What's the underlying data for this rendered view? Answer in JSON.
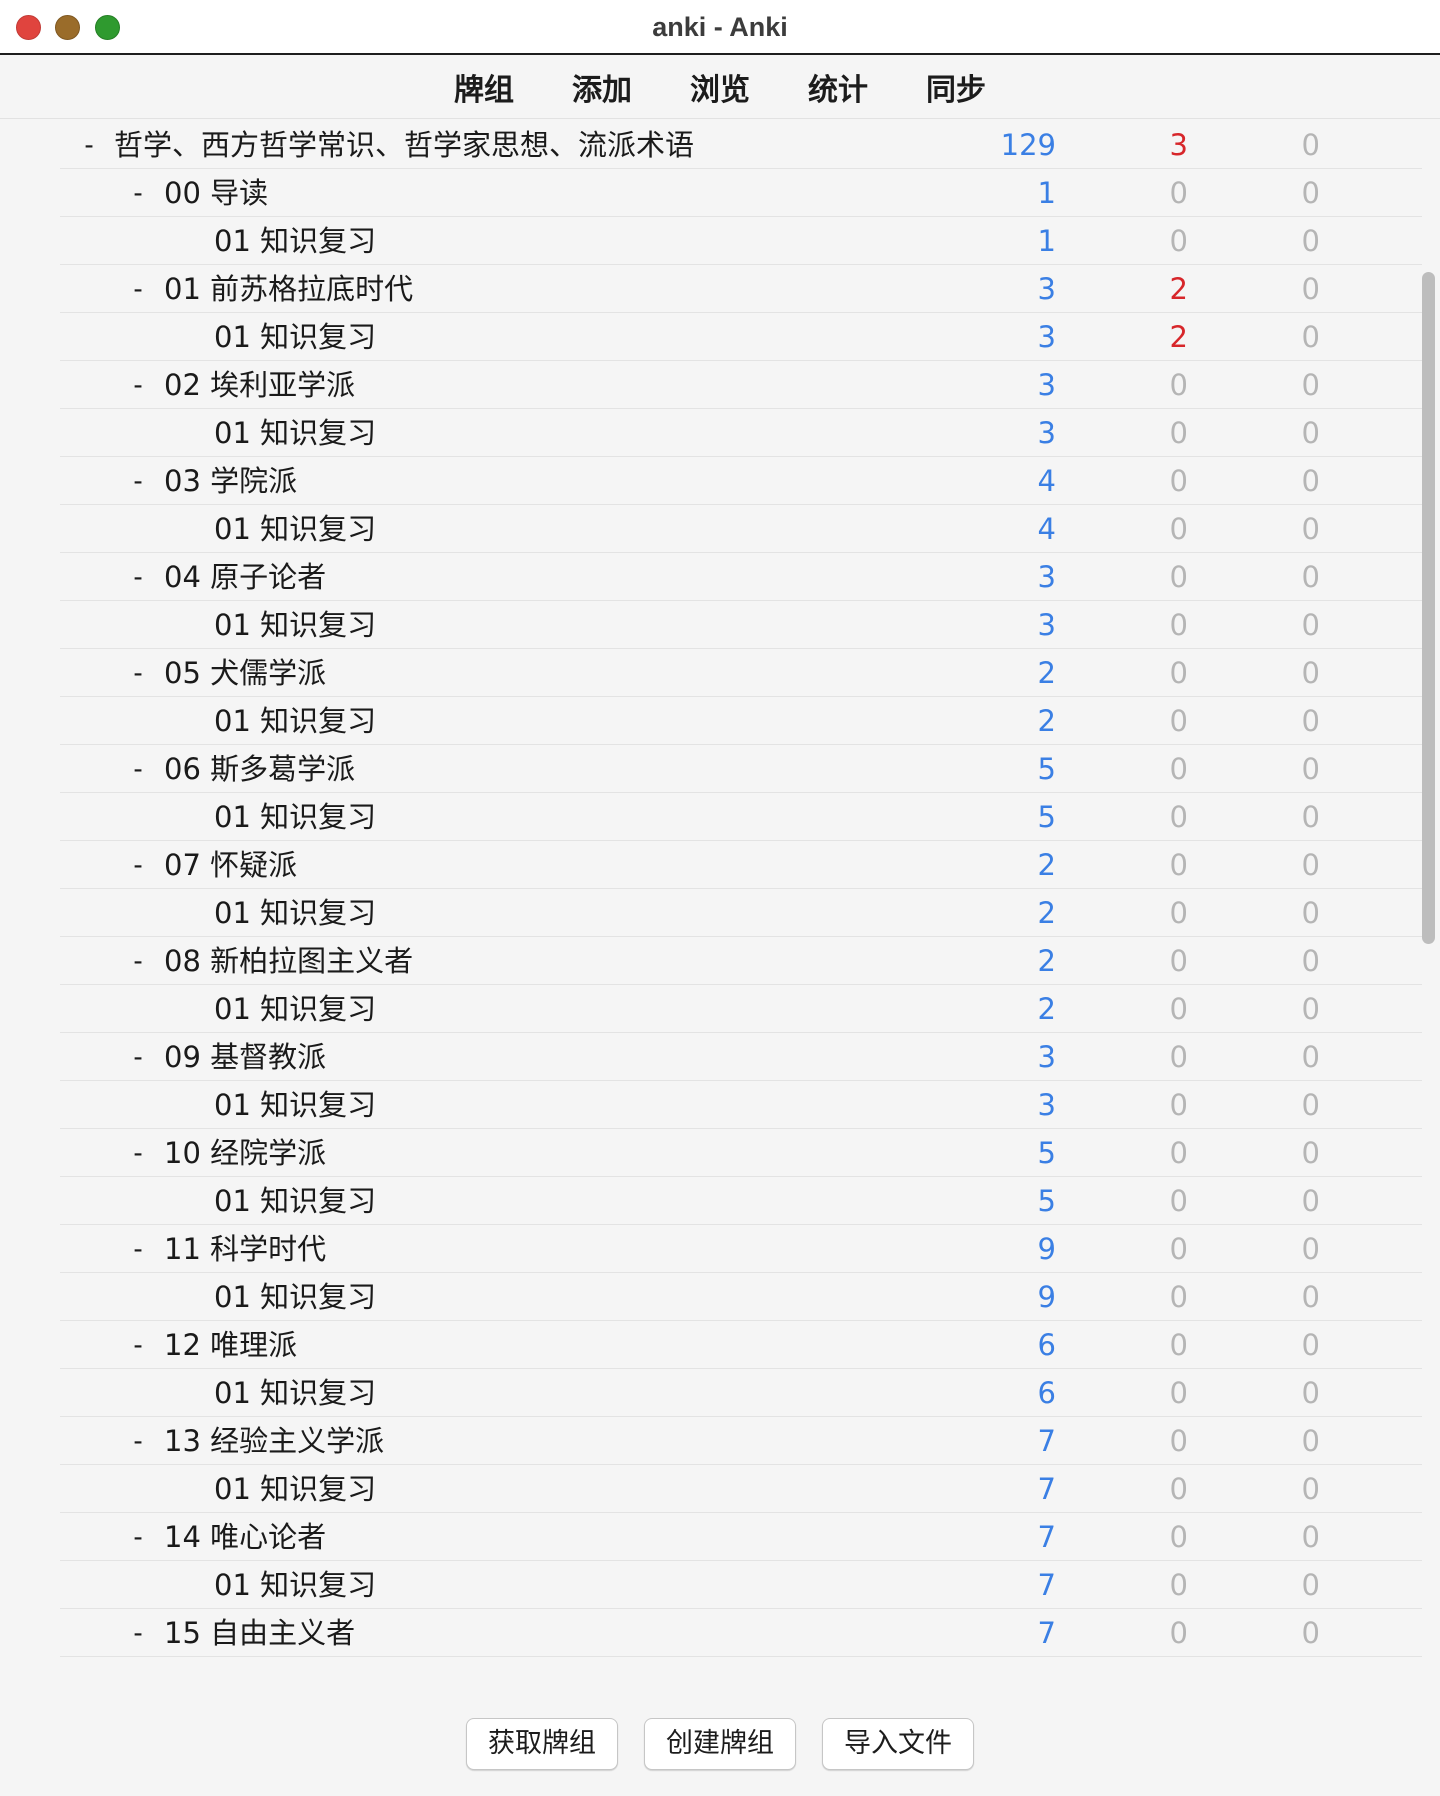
{
  "window": {
    "title": "anki - Anki"
  },
  "toolbar": {
    "items": [
      "牌组",
      "添加",
      "浏览",
      "统计",
      "同步"
    ]
  },
  "colors": {
    "new": "#3a7fe4",
    "learn": "#d7262a",
    "zero": "#b5b5b5"
  },
  "decks": [
    {
      "level": 0,
      "collapse": "-",
      "name": "哲学、西方哲学常识、哲学家思想、流派术语",
      "new": "129",
      "learn": "3",
      "due": "0"
    },
    {
      "level": 1,
      "collapse": "-",
      "name": "00 导读",
      "new": "1",
      "learn": "0",
      "due": "0"
    },
    {
      "level": 2,
      "collapse": "",
      "name": "01 知识复习",
      "new": "1",
      "learn": "0",
      "due": "0"
    },
    {
      "level": 1,
      "collapse": "-",
      "name": "01 前苏格拉底时代",
      "new": "3",
      "learn": "2",
      "due": "0"
    },
    {
      "level": 2,
      "collapse": "",
      "name": "01 知识复习",
      "new": "3",
      "learn": "2",
      "due": "0"
    },
    {
      "level": 1,
      "collapse": "-",
      "name": "02 埃利亚学派",
      "new": "3",
      "learn": "0",
      "due": "0"
    },
    {
      "level": 2,
      "collapse": "",
      "name": "01 知识复习",
      "new": "3",
      "learn": "0",
      "due": "0"
    },
    {
      "level": 1,
      "collapse": "-",
      "name": "03 学院派",
      "new": "4",
      "learn": "0",
      "due": "0"
    },
    {
      "level": 2,
      "collapse": "",
      "name": "01 知识复习",
      "new": "4",
      "learn": "0",
      "due": "0"
    },
    {
      "level": 1,
      "collapse": "-",
      "name": "04 原子论者",
      "new": "3",
      "learn": "0",
      "due": "0"
    },
    {
      "level": 2,
      "collapse": "",
      "name": "01 知识复习",
      "new": "3",
      "learn": "0",
      "due": "0"
    },
    {
      "level": 1,
      "collapse": "-",
      "name": "05 犬儒学派",
      "new": "2",
      "learn": "0",
      "due": "0"
    },
    {
      "level": 2,
      "collapse": "",
      "name": "01 知识复习",
      "new": "2",
      "learn": "0",
      "due": "0"
    },
    {
      "level": 1,
      "collapse": "-",
      "name": "06 斯多葛学派",
      "new": "5",
      "learn": "0",
      "due": "0"
    },
    {
      "level": 2,
      "collapse": "",
      "name": "01 知识复习",
      "new": "5",
      "learn": "0",
      "due": "0"
    },
    {
      "level": 1,
      "collapse": "-",
      "name": "07 怀疑派",
      "new": "2",
      "learn": "0",
      "due": "0"
    },
    {
      "level": 2,
      "collapse": "",
      "name": "01 知识复习",
      "new": "2",
      "learn": "0",
      "due": "0"
    },
    {
      "level": 1,
      "collapse": "-",
      "name": "08 新柏拉图主义者",
      "new": "2",
      "learn": "0",
      "due": "0"
    },
    {
      "level": 2,
      "collapse": "",
      "name": "01 知识复习",
      "new": "2",
      "learn": "0",
      "due": "0"
    },
    {
      "level": 1,
      "collapse": "-",
      "name": "09 基督教派",
      "new": "3",
      "learn": "0",
      "due": "0"
    },
    {
      "level": 2,
      "collapse": "",
      "name": "01 知识复习",
      "new": "3",
      "learn": "0",
      "due": "0"
    },
    {
      "level": 1,
      "collapse": "-",
      "name": "10 经院学派",
      "new": "5",
      "learn": "0",
      "due": "0"
    },
    {
      "level": 2,
      "collapse": "",
      "name": "01 知识复习",
      "new": "5",
      "learn": "0",
      "due": "0"
    },
    {
      "level": 1,
      "collapse": "-",
      "name": "11 科学时代",
      "new": "9",
      "learn": "0",
      "due": "0"
    },
    {
      "level": 2,
      "collapse": "",
      "name": "01 知识复习",
      "new": "9",
      "learn": "0",
      "due": "0"
    },
    {
      "level": 1,
      "collapse": "-",
      "name": "12 唯理派",
      "new": "6",
      "learn": "0",
      "due": "0"
    },
    {
      "level": 2,
      "collapse": "",
      "name": "01 知识复习",
      "new": "6",
      "learn": "0",
      "due": "0"
    },
    {
      "level": 1,
      "collapse": "-",
      "name": "13 经验主义学派",
      "new": "7",
      "learn": "0",
      "due": "0"
    },
    {
      "level": 2,
      "collapse": "",
      "name": "01 知识复习",
      "new": "7",
      "learn": "0",
      "due": "0"
    },
    {
      "level": 1,
      "collapse": "-",
      "name": "14 唯心论者",
      "new": "7",
      "learn": "0",
      "due": "0"
    },
    {
      "level": 2,
      "collapse": "",
      "name": "01 知识复习",
      "new": "7",
      "learn": "0",
      "due": "0"
    },
    {
      "level": 1,
      "collapse": "-",
      "name": "15 自由主义者",
      "new": "7",
      "learn": "0",
      "due": "0"
    }
  ],
  "bottom_buttons": {
    "get_shared": "获取牌组",
    "create_deck": "创建牌组",
    "import_file": "导入文件"
  }
}
